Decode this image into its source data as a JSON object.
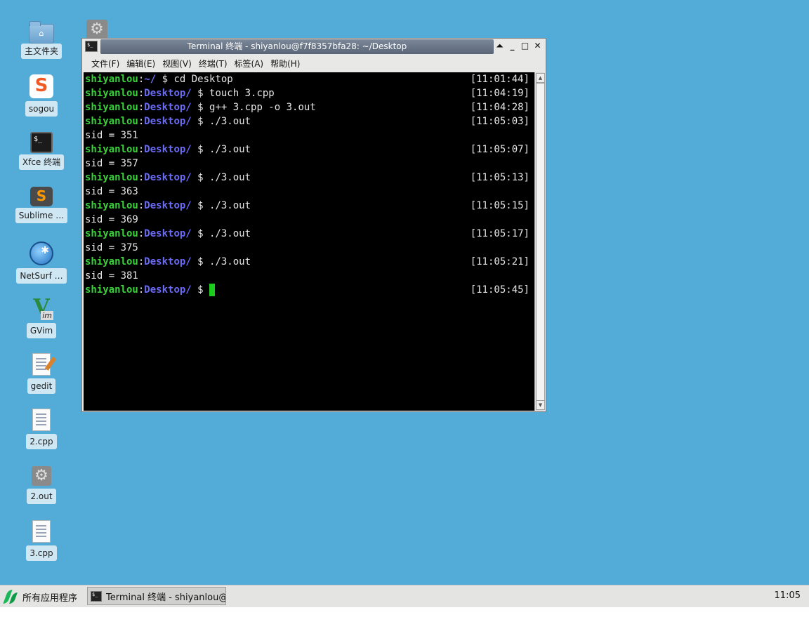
{
  "desktop": {
    "icons": [
      {
        "label": "主文件夹",
        "icon": "home-folder-icon"
      },
      {
        "label": "sogou",
        "icon": "sogou-icon"
      },
      {
        "label": "Xfce 终端",
        "icon": "terminal-icon"
      },
      {
        "label": "Sublime …",
        "icon": "sublime-text-icon"
      },
      {
        "label": "NetSurf …",
        "icon": "netsurf-globe-icon"
      },
      {
        "label": "GVim",
        "icon": "gvim-icon"
      },
      {
        "label": "gedit",
        "icon": "gedit-icon"
      },
      {
        "label": "2.cpp",
        "icon": "cpp-file-icon"
      },
      {
        "label": "2.out",
        "icon": "executable-gear-icon"
      },
      {
        "label": "3.cpp",
        "icon": "cpp-file-icon"
      }
    ]
  },
  "window": {
    "title": "Terminal 终端 - shiyanlou@f7f8357bfa28: ~/Desktop",
    "controls": {
      "shade": "⏶",
      "minimize": "_",
      "maximize": "□",
      "close": "✕"
    },
    "menu": [
      "文件(F)",
      "编辑(E)",
      "视图(V)",
      "终端(T)",
      "标签(A)",
      "帮助(H)"
    ]
  },
  "terminal": {
    "lines": [
      {
        "user": "shiyanlou",
        "sep": ":",
        "path": "~/",
        "cmd": " $ cd Desktop",
        "time": "[11:01:44]"
      },
      {
        "user": "shiyanlou",
        "sep": ":",
        "path": "Desktop/",
        "cmd": " $ touch 3.cpp",
        "time": "[11:04:19]"
      },
      {
        "user": "shiyanlou",
        "sep": ":",
        "path": "Desktop/",
        "cmd": " $ g++ 3.cpp -o 3.out",
        "time": "[11:04:28]"
      },
      {
        "user": "shiyanlou",
        "sep": ":",
        "path": "Desktop/",
        "cmd": " $ ./3.out",
        "time": "[11:05:03]"
      },
      {
        "output": "sid = 351"
      },
      {
        "user": "shiyanlou",
        "sep": ":",
        "path": "Desktop/",
        "cmd": " $ ./3.out",
        "time": "[11:05:07]"
      },
      {
        "output": "sid = 357"
      },
      {
        "user": "shiyanlou",
        "sep": ":",
        "path": "Desktop/",
        "cmd": " $ ./3.out",
        "time": "[11:05:13]"
      },
      {
        "output": "sid = 363"
      },
      {
        "user": "shiyanlou",
        "sep": ":",
        "path": "Desktop/",
        "cmd": " $ ./3.out",
        "time": "[11:05:15]"
      },
      {
        "output": "sid = 369"
      },
      {
        "user": "shiyanlou",
        "sep": ":",
        "path": "Desktop/",
        "cmd": " $ ./3.out",
        "time": "[11:05:17]"
      },
      {
        "output": "sid = 375"
      },
      {
        "user": "shiyanlou",
        "sep": ":",
        "path": "Desktop/",
        "cmd": " $ ./3.out",
        "time": "[11:05:21]"
      },
      {
        "output": "sid = 381"
      },
      {
        "user": "shiyanlou",
        "sep": ":",
        "path": "Desktop/",
        "cmd": " $ ",
        "time": "[11:05:45]",
        "cursor": true
      }
    ]
  },
  "taskbar": {
    "start_label": "所有应用程序",
    "task_label": "Terminal 终端 - shiyanlou@f…",
    "clock": "11:05"
  },
  "colors": {
    "desktop_bg": "#53acd8",
    "prompt_user": "#38d43a",
    "prompt_path": "#6b6cf5",
    "cursor": "#1ccc1c"
  }
}
